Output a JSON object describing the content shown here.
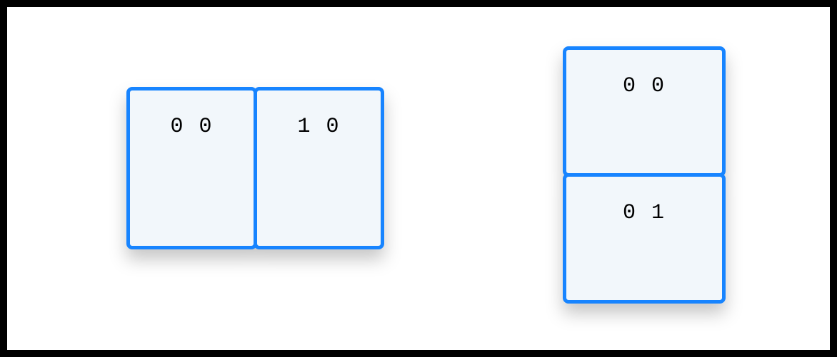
{
  "groups": {
    "horizontal": {
      "cards": [
        {
          "label": "0 0"
        },
        {
          "label": "1 0"
        }
      ]
    },
    "vertical": {
      "cards": [
        {
          "label": "0 0"
        },
        {
          "label": "0 1"
        }
      ]
    }
  }
}
